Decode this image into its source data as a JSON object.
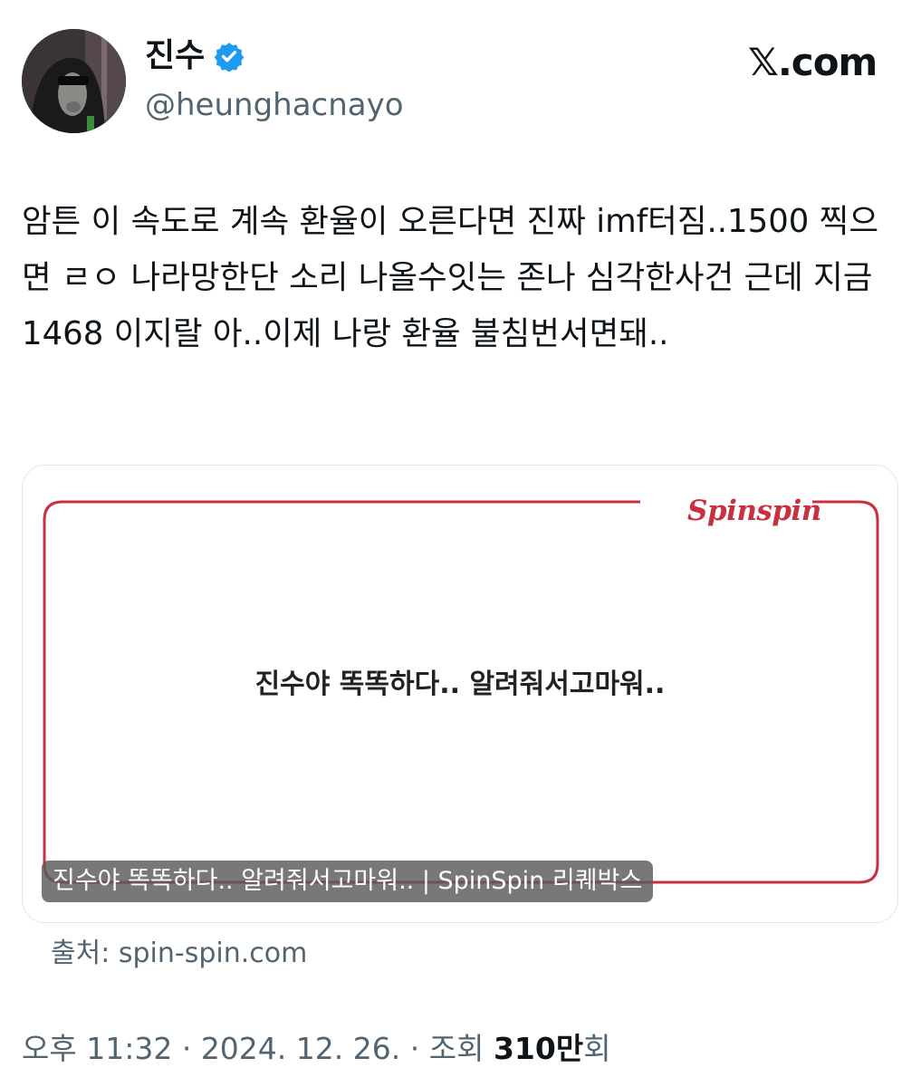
{
  "user": {
    "display_name": "진수",
    "handle": "@heunghacnayo",
    "verified": true
  },
  "brand": {
    "logo_text": "𝕏.com"
  },
  "tweet": {
    "text": "암튼 이 속도로 계속 환율이 오른다면 진짜 imf터짐..1500 찍으면 ㄹㅇ 나라망한단 소리 나올수잇는 존나 심각한사건 근데 지금 1468 이지랄 아..이제 나랑 환율 불침번서면돼.."
  },
  "card": {
    "logo_text": "Spinspin",
    "message": "진수야 똑똑하다.. 알려줘서고마워..",
    "caption": "진수야 똑똑하다.. 알려줘서고마워.. | SpinSpin 리퀘박스",
    "source": "출처: spin-spin.com",
    "accent_color": "#c8303f"
  },
  "meta": {
    "time": "오후 11:32",
    "separator": "·",
    "date": "2024. 12. 26.",
    "views_label": "조회",
    "views_count": "310만",
    "views_suffix": "회"
  }
}
